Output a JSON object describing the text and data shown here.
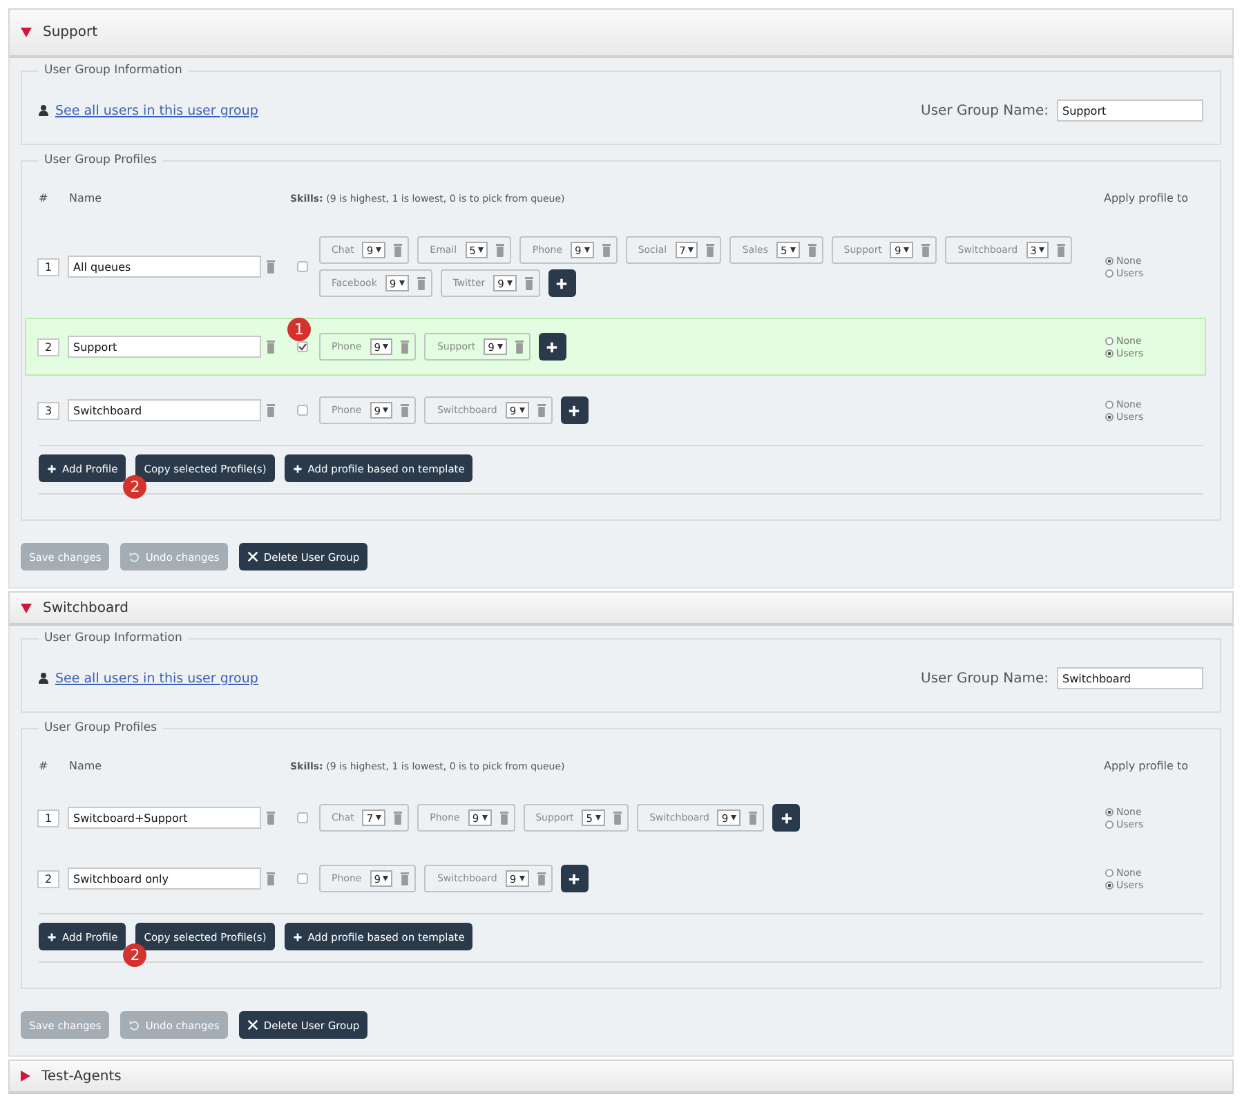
{
  "groups": [
    {
      "title": "Support",
      "expanded": true,
      "info_legend": "User Group Information",
      "users_link": "See all users in this user group",
      "name_label": "User Group Name:",
      "name_value": "Support",
      "profiles_legend": "User Group Profiles",
      "headers": {
        "number": "#",
        "name": "Name",
        "skills": "**Skills:** (9 is highest, 1 is lowest, 0 is to pick from queue)",
        "apply": "Apply profile to"
      },
      "profiles": [
        {
          "number": "1",
          "name": "All queues",
          "checked": false,
          "skills": [
            {
              "name": "Chat",
              "value": "9"
            },
            {
              "name": "Email",
              "value": "5"
            },
            {
              "name": "Phone",
              "value": "9"
            },
            {
              "name": "Social",
              "value": "7"
            },
            {
              "name": "Sales",
              "value": "5"
            },
            {
              "name": "Support",
              "value": "9"
            },
            {
              "name": "Switchboard",
              "value": "3"
            },
            {
              "name": "Facebook",
              "value": "9"
            },
            {
              "name": "Twitter",
              "value": "9"
            }
          ],
          "apply": [
            {
              "label": "None",
              "selected": true
            },
            {
              "label": "Users",
              "selected": false
            }
          ]
        },
        {
          "number": "2",
          "name": "Support",
          "checked": true,
          "marker": "1",
          "skills": [
            {
              "name": "Phone",
              "value": "9"
            },
            {
              "name": "Support",
              "value": "9"
            }
          ],
          "apply": [
            {
              "label": "None",
              "selected": false
            },
            {
              "label": "Users",
              "selected": true
            }
          ]
        },
        {
          "number": "3",
          "name": "Switchboard",
          "checked": false,
          "skills": [
            {
              "name": "Phone",
              "value": "9"
            },
            {
              "name": "Switchboard",
              "value": "9"
            }
          ],
          "apply": [
            {
              "label": "None",
              "selected": false
            },
            {
              "label": "Users",
              "selected": true
            }
          ]
        }
      ],
      "profile_buttons": [
        {
          "label": "Add Profile",
          "kind": "add"
        },
        {
          "label": "Copy selected Profile(s)",
          "kind": "plain",
          "marker": "2"
        },
        {
          "label": "Add profile based on template",
          "kind": "add"
        }
      ],
      "actions": [
        {
          "label": "Save changes",
          "kind": "plain",
          "disabled": true
        },
        {
          "label": "Undo changes",
          "kind": "undo",
          "disabled": true
        },
        {
          "label": "Delete User Group",
          "kind": "delete",
          "disabled": false
        }
      ]
    },
    {
      "title": "Switchboard",
      "expanded": true,
      "info_legend": "User Group Information",
      "users_link": "See all users in this user group",
      "name_label": "User Group Name:",
      "name_value": "Switchboard",
      "profiles_legend": "User Group Profiles",
      "headers": {
        "number": "#",
        "name": "Name",
        "skills": "**Skills:** (9 is highest, 1 is lowest, 0 is to pick from queue)",
        "apply": "Apply profile to"
      },
      "profiles": [
        {
          "number": "1",
          "name": "Switcboard+Support",
          "checked": false,
          "skills": [
            {
              "name": "Chat",
              "value": "7"
            },
            {
              "name": "Phone",
              "value": "9"
            },
            {
              "name": "Support",
              "value": "5"
            },
            {
              "name": "Switchboard",
              "value": "9"
            }
          ],
          "apply": [
            {
              "label": "None",
              "selected": true
            },
            {
              "label": "Users",
              "selected": false
            }
          ]
        },
        {
          "number": "2",
          "name": "Switchboard only",
          "checked": false,
          "skills": [
            {
              "name": "Phone",
              "value": "9"
            },
            {
              "name": "Switchboard",
              "value": "9"
            }
          ],
          "apply": [
            {
              "label": "None",
              "selected": false
            },
            {
              "label": "Users",
              "selected": true
            }
          ]
        }
      ],
      "profile_buttons": [
        {
          "label": "Add Profile",
          "kind": "add"
        },
        {
          "label": "Copy selected Profile(s)",
          "kind": "plain",
          "marker": "2"
        },
        {
          "label": "Add profile based on template",
          "kind": "add"
        }
      ],
      "actions": [
        {
          "label": "Save changes",
          "kind": "plain",
          "disabled": true
        },
        {
          "label": "Undo changes",
          "kind": "undo",
          "disabled": true
        },
        {
          "label": "Delete User Group",
          "kind": "delete",
          "disabled": false
        }
      ]
    },
    {
      "title": "Test-Agents",
      "expanded": false
    }
  ]
}
